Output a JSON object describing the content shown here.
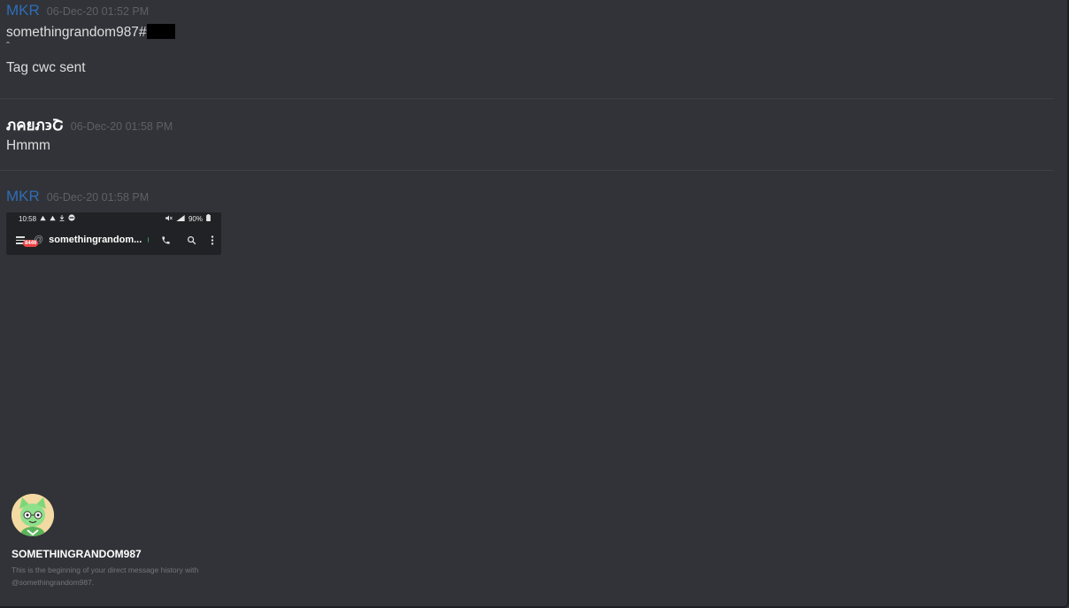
{
  "messages": [
    {
      "author": "MKR",
      "timestamp": "06-Dec-20 01:52 PM",
      "line1": "somethingrandom987#",
      "caret": "ˆ",
      "line2": "Tag cwc sent"
    },
    {
      "author": "ภคยภ϶Շ",
      "timestamp": "06-Dec-20 01:58 PM",
      "text": "Hmmm"
    },
    {
      "author": "MKR",
      "timestamp": "06-Dec-20 01:58 PM"
    }
  ],
  "attachment": {
    "time": "10:58",
    "battery": "90%",
    "badge": "8446",
    "channel_name": "somethingrandom...",
    "status_color": "#3ba55c"
  },
  "intro": {
    "username": "SOMETHINGRANDOM987",
    "line1": "This is the beginning of your direct message history with",
    "line2": "@somethingrandom987."
  },
  "colors": {
    "background": "#313338",
    "author_mkr": "#2f6db5",
    "timestamp": "#5d6068",
    "text": "#dcddde"
  },
  "icons": [
    "menu-icon",
    "at-icon",
    "phone-icon",
    "search-icon",
    "more-icon",
    "alert-icon",
    "download-icon",
    "mute-icon",
    "signal-icon",
    "battery-icon"
  ]
}
